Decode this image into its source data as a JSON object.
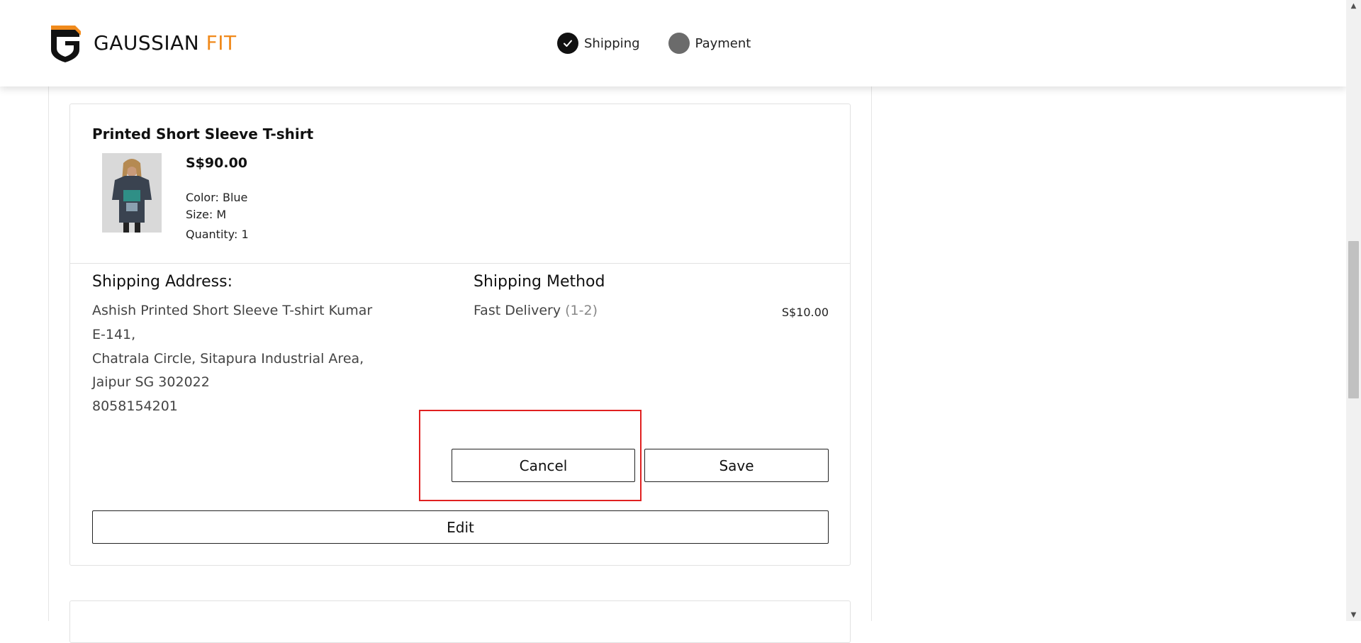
{
  "brand": {
    "name_main": "GAUSSIAN ",
    "name_accent": "FIT",
    "accent_color": "#f08a1c",
    "logo_icon": "gaussian-fit-logo-icon"
  },
  "steps": [
    {
      "label": "Shipping",
      "state": "done",
      "icon": "check-icon"
    },
    {
      "label": "Payment",
      "state": "pending",
      "icon": "circle-icon"
    }
  ],
  "product": {
    "title": "Printed Short Sleeve T-shirt",
    "price": "S$90.00",
    "color": "Color: Blue",
    "size": "Size: M",
    "quantity": "Quantity: 1",
    "image_icon": "tshirt-product-image"
  },
  "shipping_address": {
    "heading": "Shipping Address:",
    "lines": [
      "Ashish Printed Short Sleeve T-shirt Kumar",
      "E-141,",
      "Chatrala Circle, Sitapura Industrial Area,",
      "Jaipur SG 302022",
      "8058154201"
    ]
  },
  "shipping_method": {
    "heading": "Shipping Method",
    "name": "Fast Delivery ",
    "days": "(1-2)",
    "price": "S$10.00"
  },
  "buttons": {
    "cancel": "Cancel",
    "save": "Save",
    "edit": "Edit"
  },
  "colors": {
    "highlight": "#e02020",
    "step_done": "#111111",
    "step_pending": "#6b6b6b"
  }
}
